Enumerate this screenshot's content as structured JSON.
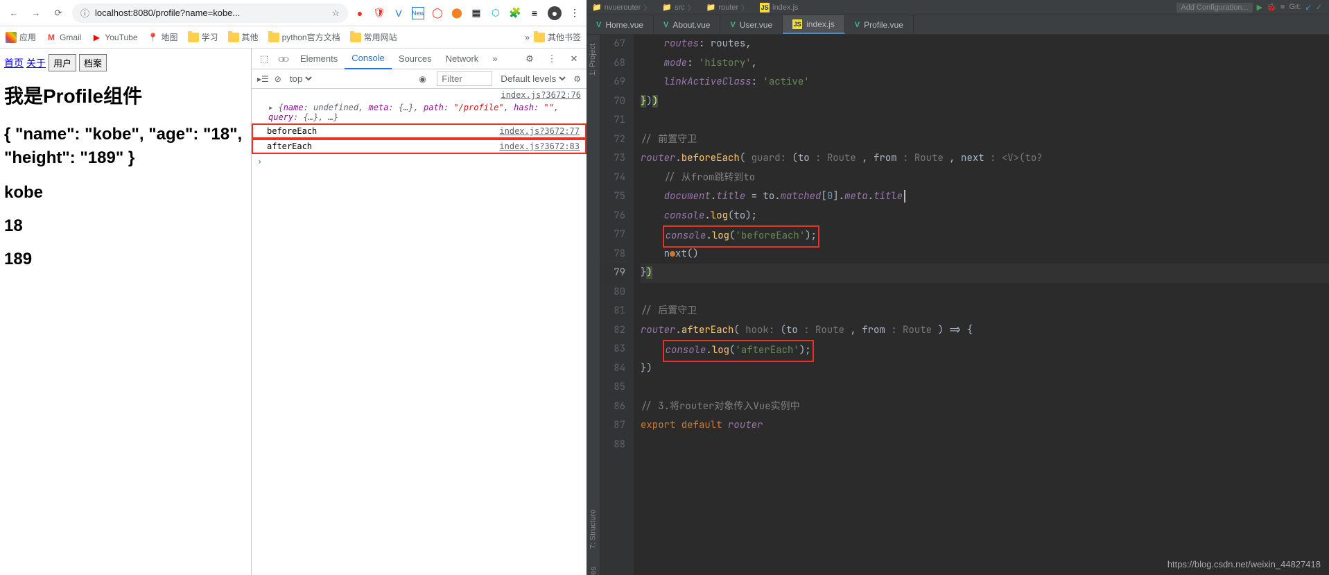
{
  "browser": {
    "url": "localhost:8080/profile?name=kobe...",
    "bookmarks_label": "应用",
    "bookmarks": [
      {
        "icon": "gmail",
        "label": "Gmail"
      },
      {
        "icon": "youtube",
        "label": "YouTube"
      },
      {
        "icon": "maps",
        "label": "地图"
      },
      {
        "icon": "folder",
        "label": "学习"
      },
      {
        "icon": "folder",
        "label": "其他"
      },
      {
        "icon": "folder",
        "label": "python官方文档"
      },
      {
        "icon": "folder",
        "label": "常用网站"
      }
    ],
    "overflow_bookmark": {
      "icon": "folder",
      "label": "其他书签"
    }
  },
  "page": {
    "nav_home": "首页",
    "nav_about": "关于",
    "btn_user": "用户",
    "btn_archive": "档案",
    "heading": "我是Profile组件",
    "json_text": "{ \"name\": \"kobe\", \"age\": \"18\", \"height\": \"189\" }",
    "v1": "kobe",
    "v2": "18",
    "v3": "189"
  },
  "devtools": {
    "tabs": [
      "Elements",
      "Console",
      "Sources",
      "Network"
    ],
    "active_tab": "Console",
    "context": "top",
    "filter_placeholder": "Filter",
    "levels": "Default levels",
    "header_src": "index.js?3672:76",
    "expand_line": "{name: undefined, meta: {…}, path: \"/profile\", hash: \"\", query: {…}, …}",
    "logs": [
      {
        "msg": "beforeEach",
        "src": "index.js?3672:77"
      },
      {
        "msg": "afterEach",
        "src": "index.js?3672:83"
      }
    ]
  },
  "ide": {
    "breadcrumbs": [
      "nvuerouter",
      "src",
      "router",
      "index.js"
    ],
    "run_config": "Add Configuration...",
    "git_label": "Git:",
    "tabs": [
      {
        "type": "vue",
        "label": "Home.vue"
      },
      {
        "type": "vue",
        "label": "About.vue"
      },
      {
        "type": "vue",
        "label": "User.vue"
      },
      {
        "type": "js",
        "label": "index.js",
        "active": true
      },
      {
        "type": "vue",
        "label": "Profile.vue"
      }
    ],
    "side_top": "1: Project",
    "side_bottom": "7: Structure",
    "side_bottom2": "es",
    "code_lines": [
      {
        "n": 67,
        "html": "    <span class='id'>routes</span>: routes,"
      },
      {
        "n": 68,
        "html": "    <span class='id'>mode</span>: <span class='str'>'history'</span>,"
      },
      {
        "n": 69,
        "html": "    <span class='id'>linkActiveClass</span>: <span class='str'>'active'</span>"
      },
      {
        "n": 70,
        "html": "<span class='paren-y'>}</span>)<span class='paren-y'>)</span>"
      },
      {
        "n": 71,
        "html": ""
      },
      {
        "n": 72,
        "html": "<span class='cmt'>// 前置守卫</span>"
      },
      {
        "n": 73,
        "html": "<span class='id'>router</span>.<span class='fn'>beforeEach</span>( <span class='hint'>guard:</span> (to <span class='hint'>: Route</span> , from <span class='hint'>: Route</span> , next <span class='hint'>: &lt;V&gt;(to?</span>"
      },
      {
        "n": 74,
        "html": "    <span class='cmt'>// 从from跳转到to</span>"
      },
      {
        "n": 75,
        "html": "    <span class='id'>document</span>.<span class='id'>title</span> = to.<span class='id'>matched</span>[<span class='num'>0</span>].<span class='id'>meta</span>.<span class='id'>title</span><span class='caret-block'></span>"
      },
      {
        "n": 76,
        "html": "    <span class='id'>console</span>.<span class='fn'>log</span>(to);"
      },
      {
        "n": 77,
        "html": "    <span class='red-box'><span class='id'>console</span>.<span class='fn'>log</span>(<span class='str'>'beforeEach'</span>);</span>"
      },
      {
        "n": 78,
        "html": "    n<span class='dot-warn'></span>xt()"
      },
      {
        "n": 79,
        "html": "}<span class='paren-y'>)</span>",
        "active": true
      },
      {
        "n": 80,
        "html": ""
      },
      {
        "n": 81,
        "html": "<span class='cmt'>// 后置守卫</span>"
      },
      {
        "n": 82,
        "html": "<span class='id'>router</span>.<span class='fn'>afterEach</span>( <span class='hint'>hook:</span> (to <span class='hint'>: Route</span> , from <span class='hint'>: Route</span> ) =&gt; {"
      },
      {
        "n": 83,
        "html": "    <span class='red-box'><span class='id'>console</span>.<span class='fn'>log</span>(<span class='str'>'afterEach'</span>);</span>"
      },
      {
        "n": 84,
        "html": "})"
      },
      {
        "n": 85,
        "html": ""
      },
      {
        "n": 86,
        "html": "<span class='cmt'>// 3.将router对象传入Vue实例中</span>"
      },
      {
        "n": 87,
        "html": "<span class='kw'>export default</span> <span class='id'>router</span>"
      },
      {
        "n": 88,
        "html": ""
      }
    ]
  },
  "watermark": "https://blog.csdn.net/weixin_44827418"
}
